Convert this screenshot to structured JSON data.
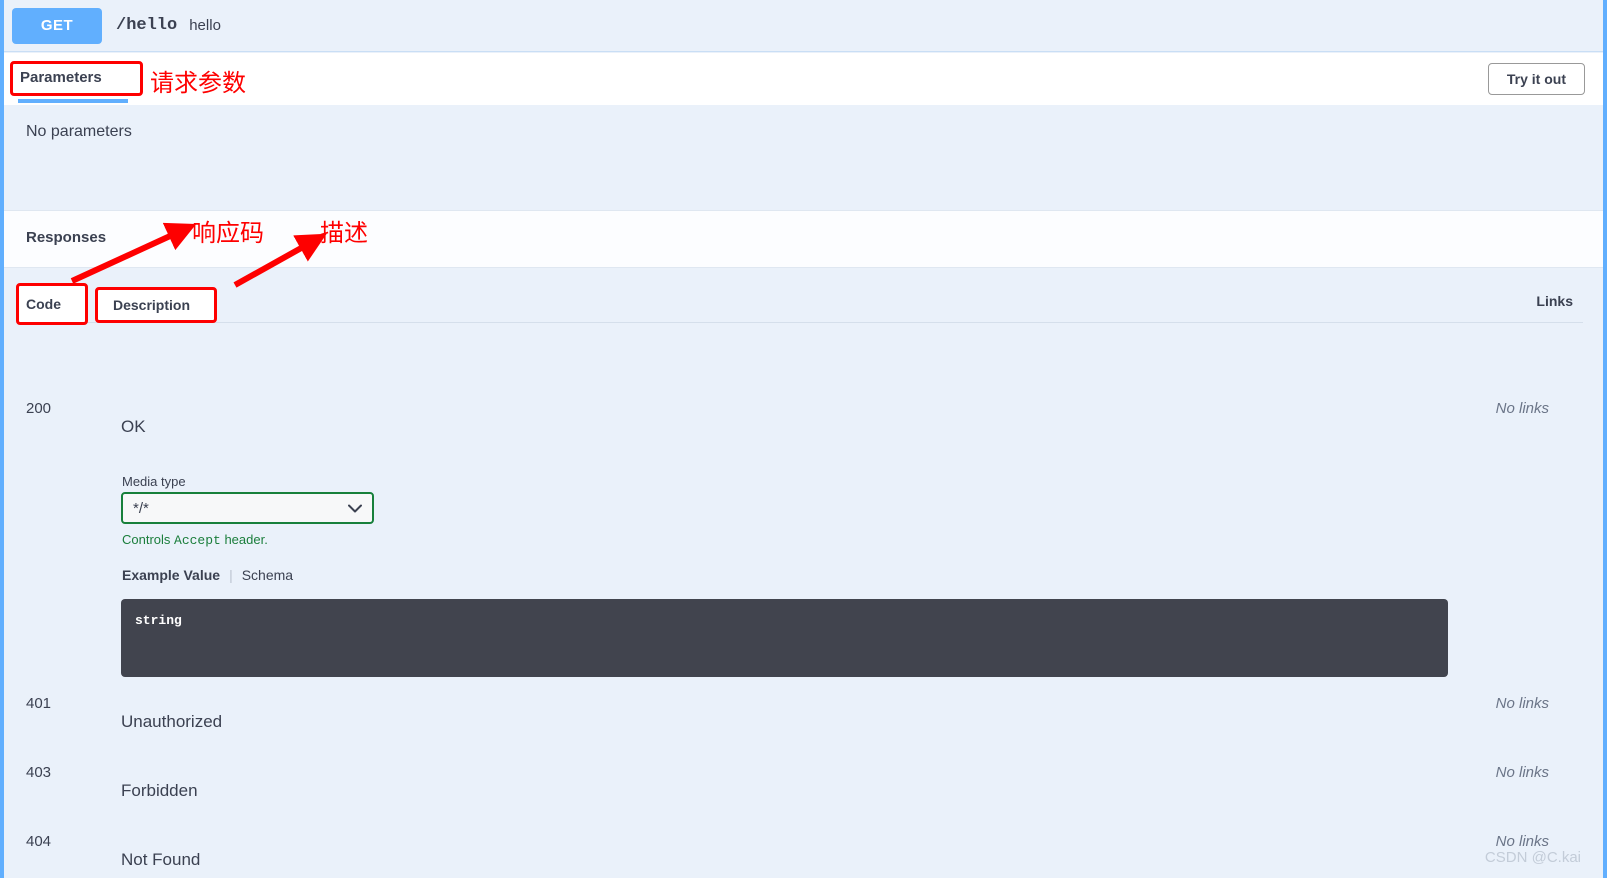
{
  "operation": {
    "method": "GET",
    "path": "/hello",
    "summary": "hello"
  },
  "parameters": {
    "section_title": "Parameters",
    "try_it_out_label": "Try it out",
    "empty_text": "No parameters"
  },
  "responses": {
    "section_title": "Responses",
    "columns": {
      "code": "Code",
      "description": "Description",
      "links": "Links"
    },
    "rows": [
      {
        "code": "200",
        "description": "OK",
        "links": "No links",
        "media_type_label": "Media type",
        "media_type_value": "*/*",
        "accept_note_prefix": "Controls ",
        "accept_note_code": "Accept",
        "accept_note_suffix": " header.",
        "example_tab": "Example Value",
        "schema_tab": "Schema",
        "example_code": "string"
      },
      {
        "code": "401",
        "description": "Unauthorized",
        "links": "No links"
      },
      {
        "code": "403",
        "description": "Forbidden",
        "links": "No links"
      },
      {
        "code": "404",
        "description": "Not Found",
        "links": "No links"
      }
    ]
  },
  "annotations": {
    "parameters_label": "请求参数",
    "code_label": "响应码",
    "description_label": "描述"
  },
  "watermark": "CSDN @C.kai",
  "colors": {
    "get_badge": "#61affe",
    "panel_bg": "#eaf1fa",
    "annotation_red": "#fe0000",
    "select_border_green": "#17803b",
    "code_block_bg": "#41444e"
  }
}
